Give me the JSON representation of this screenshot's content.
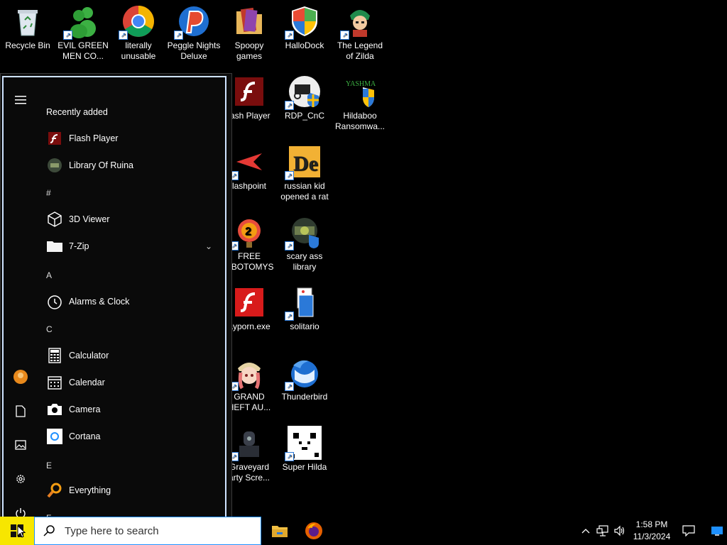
{
  "desktop": {
    "icons": [
      {
        "label": "Recycle Bin",
        "icon": "recycle-bin-icon",
        "shortcut": false
      },
      {
        "label": "EVIL GREEN\nMEN CO...",
        "icon": "messenger-icon",
        "shortcut": true
      },
      {
        "label": "literally\nunusable",
        "icon": "chrome-icon",
        "shortcut": true
      },
      {
        "label": "Peggle Nights\nDeluxe",
        "icon": "peggle-icon",
        "shortcut": true
      },
      {
        "label": "Spoopy\ngames",
        "icon": "folder-icon",
        "shortcut": false
      },
      {
        "label": "HalloDock",
        "icon": "windows-shield-icon",
        "shortcut": true
      },
      {
        "label": "The Legend\nof Zilda",
        "icon": "game-character-icon",
        "shortcut": true
      },
      {
        "label": "lash Player",
        "icon": "flash-icon",
        "shortcut": false
      },
      {
        "label": "RDP_CnC",
        "icon": "rdp-icon",
        "shortcut": true
      },
      {
        "label": "Hildaboo\nRansomwa...",
        "icon": "yashma-icon",
        "shortcut": false
      },
      {
        "label": "lashpoint",
        "icon": "flashpoint-icon",
        "shortcut": true
      },
      {
        "label": "russian kid\nopened a rat",
        "icon": "de-icon",
        "shortcut": true
      },
      {
        "label": "FREE\nOBOTOMYS",
        "icon": "lobotomy-icon",
        "shortcut": true
      },
      {
        "label": "scary ass\nlibrary",
        "icon": "library-icon",
        "shortcut": true
      },
      {
        "label": "ayporn.exe",
        "icon": "flash-icon",
        "shortcut": false
      },
      {
        "label": "solitario",
        "icon": "solitaire-icon",
        "shortcut": true
      },
      {
        "label": "GRAND\nHEFT AU...",
        "icon": "anime-girl-icon",
        "shortcut": true
      },
      {
        "label": "Thunderbird",
        "icon": "thunderbird-icon",
        "shortcut": true
      },
      {
        "label": "Graveyard\narty Scre...",
        "icon": "graveyard-icon",
        "shortcut": true
      },
      {
        "label": "Super Hilda",
        "icon": "pixel-dog-icon",
        "shortcut": true
      }
    ]
  },
  "start_menu": {
    "recently_added_label": "Recently added",
    "sections": [
      "#",
      "A",
      "C",
      "E",
      "F"
    ],
    "apps": [
      {
        "label": "Flash Player",
        "icon": "flash-icon"
      },
      {
        "label": "Library Of Ruina",
        "icon": "library-ruina-icon"
      },
      {
        "label": "3D Viewer",
        "icon": "cube-icon"
      },
      {
        "label": "7-Zip",
        "icon": "folder-icon",
        "expandable": true
      },
      {
        "label": "Alarms & Clock",
        "icon": "clock-icon"
      },
      {
        "label": "Calculator",
        "icon": "calculator-icon"
      },
      {
        "label": "Calendar",
        "icon": "calendar-icon"
      },
      {
        "label": "Camera",
        "icon": "camera-icon"
      },
      {
        "label": "Cortana",
        "icon": "cortana-icon"
      },
      {
        "label": "Everything",
        "icon": "magnifier-icon"
      }
    ]
  },
  "taskbar": {
    "search_placeholder": "Type here to search",
    "time": "1:58 PM",
    "date": "11/3/2024"
  },
  "colors": {
    "start_button": "#f7e600",
    "search_border": "#1e90ff",
    "accent": "#2b79d8"
  }
}
